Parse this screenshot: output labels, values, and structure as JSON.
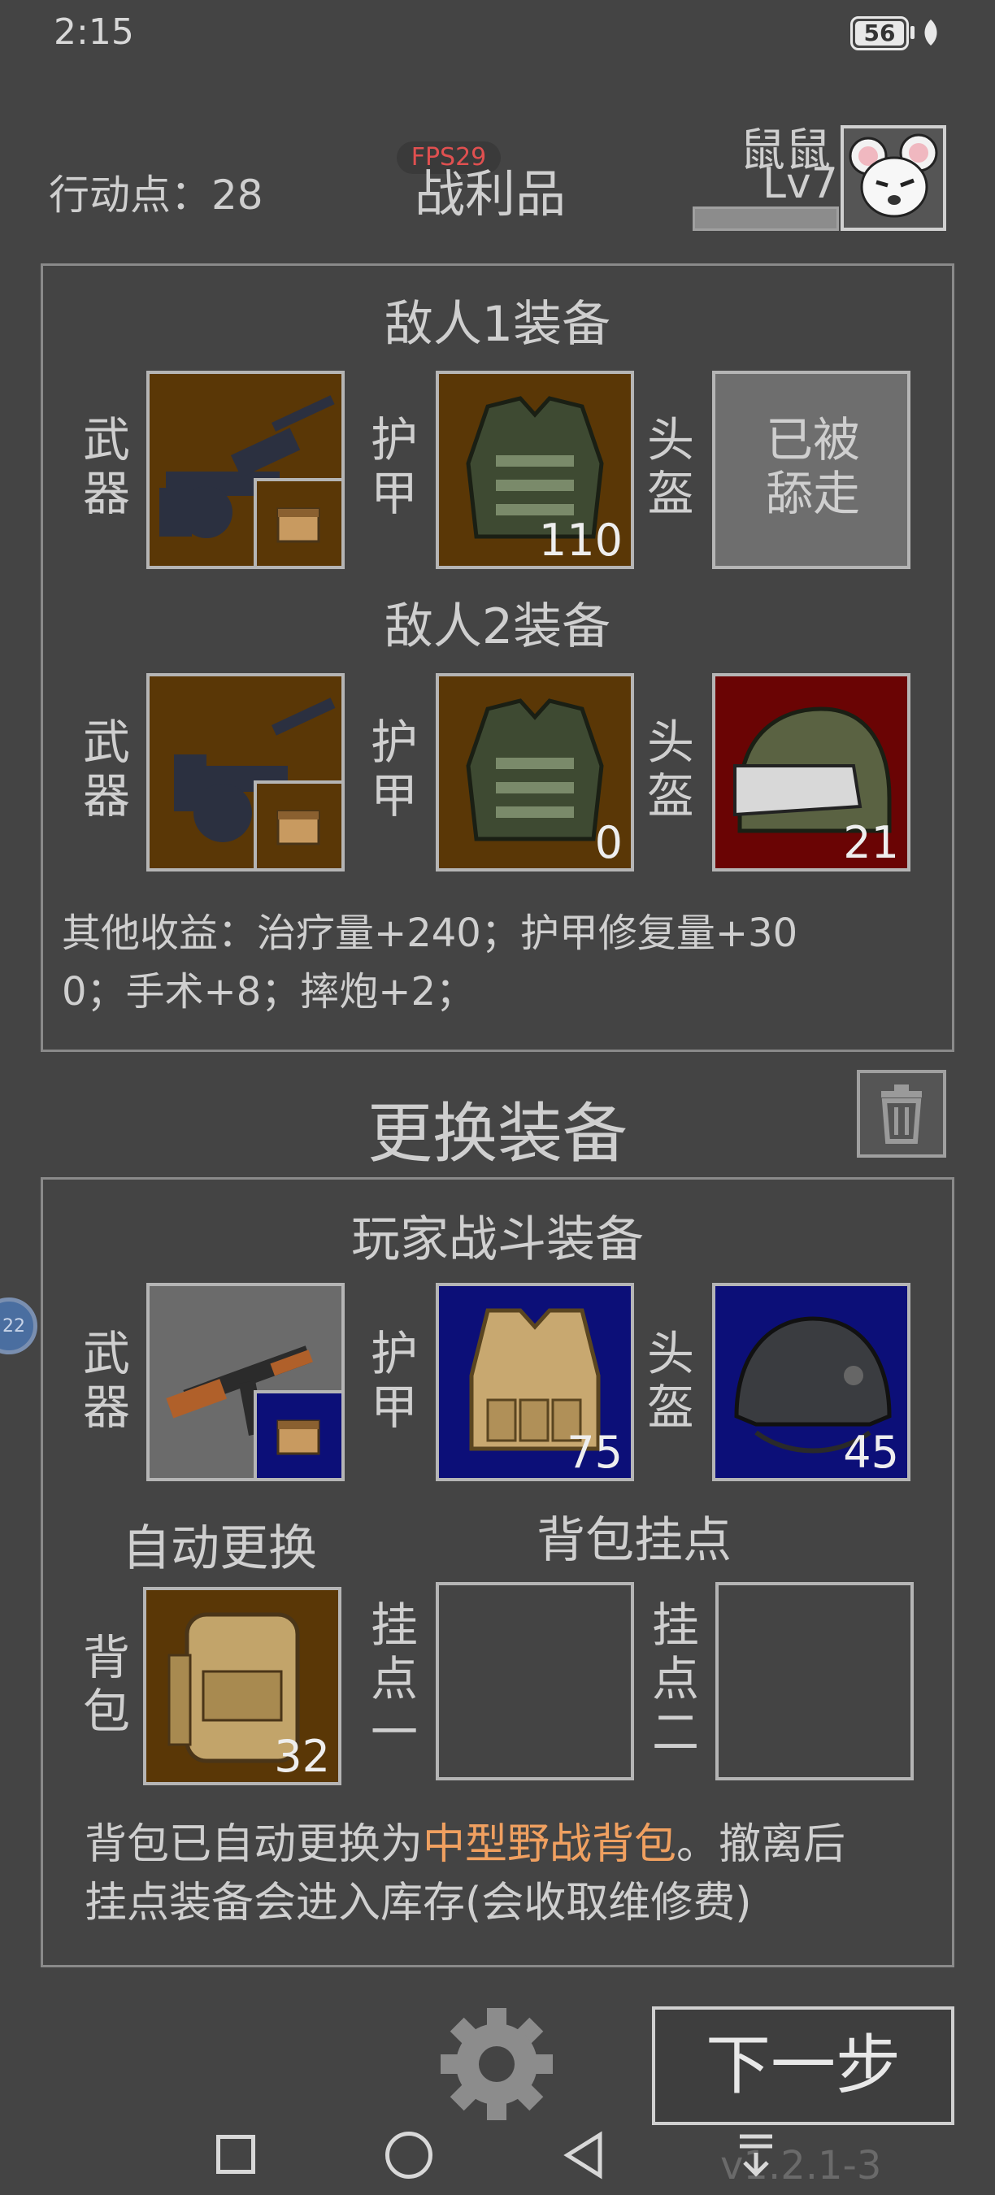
{
  "status_bar": {
    "time": "2:15",
    "battery": "56"
  },
  "header": {
    "action_points": "行动点：28",
    "title": "战利品",
    "fps": "FPS29",
    "player_name": "鼠鼠",
    "player_level": "Lv7"
  },
  "loot": {
    "enemy1_title": "敌人1装备",
    "enemy2_title": "敌人2装备",
    "weapon_label": "武器",
    "armor_label": "护甲",
    "helmet_label": "头盔",
    "enemy1": {
      "armor_value": "110",
      "helmet_status": "已被舔走"
    },
    "enemy2": {
      "armor_value": "0",
      "helmet_value": "21"
    },
    "other_gains_line1": "其他收益：治疗量+240；护甲修复量+30",
    "other_gains_line2": "0；手术+8；摔炮+2；"
  },
  "swap": {
    "title": "更换装备",
    "player_title": "玩家战斗装备",
    "weapon_label": "武器",
    "armor_label": "护甲",
    "helmet_label": "头盔",
    "armor_value": "75",
    "helmet_value": "45",
    "auto_swap_label": "自动更换",
    "backpack_mounts_title": "背包挂点",
    "backpack_label": "背包",
    "backpack_value": "32",
    "mount1_label": "挂点一",
    "mount2_label": "挂点二",
    "note_prefix": "背包已自动更换为",
    "note_highlight": "中型野战背包",
    "note_suffix": "。撤离后",
    "note_line2": "挂点装备会进入库存(会收取维修费)"
  },
  "footer": {
    "next_button": "下一步",
    "version": "v1.2.1-3",
    "floating_badge": "22"
  },
  "colors": {
    "background": "#444444",
    "text": "#cfcfcf",
    "highlight": "#f0a060",
    "slot_brown": "#5a3706",
    "slot_blue": "#0c0f78",
    "slot_red": "#6a0404",
    "fps": "#e05050"
  }
}
